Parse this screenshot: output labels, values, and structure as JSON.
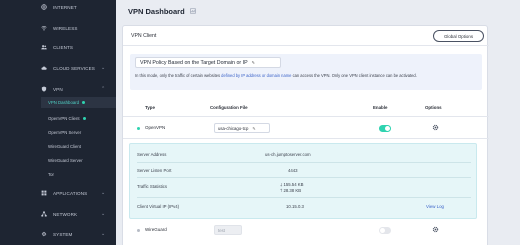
{
  "sidebar": {
    "items": [
      {
        "label": "INTERNET",
        "icon": "globe-icon"
      },
      {
        "label": "WIRELESS",
        "icon": "wifi-icon"
      },
      {
        "label": "CLIENTS",
        "icon": "users-icon"
      },
      {
        "label": "CLOUD SERVICES",
        "icon": "cloud-icon"
      },
      {
        "label": "VPN",
        "icon": "shield-icon"
      },
      {
        "label": "APPLICATIONS",
        "icon": "apps-icon"
      },
      {
        "label": "NETWORK",
        "icon": "network-icon"
      },
      {
        "label": "SYSTEM",
        "icon": "gear-icon"
      }
    ],
    "vpn_sub": [
      {
        "label": "VPN Dashboard",
        "active": true,
        "dot": true
      },
      {
        "label": "OpenVPN Client",
        "active": false,
        "dot": true
      },
      {
        "label": "OpenVPN Server",
        "active": false,
        "dot": false
      },
      {
        "label": "WireGuard Client",
        "active": false,
        "dot": false
      },
      {
        "label": "WireGuard Server",
        "active": false,
        "dot": false
      },
      {
        "label": "Tor",
        "active": false,
        "dot": false
      }
    ]
  },
  "page": {
    "title": "VPN Dashboard"
  },
  "vpn_client": {
    "title": "VPN Client",
    "global_options": "Global Options",
    "policy": {
      "selected": "VPN Policy Based on the Target Domain or IP",
      "desc_pre": "In this mode, only the traffic of certain websites",
      "desc_link": "defined by IP address or domain name",
      "desc_post": "can access the VPN. Only one VPN client instance can be activated."
    },
    "columns": {
      "type": "Type",
      "config": "Configuration File",
      "enable": "Enable",
      "options": "Options"
    },
    "rows": [
      {
        "type": "OpenVPN",
        "config": "usa-chicago-tcp",
        "enabled": true,
        "status_color": "#2fd3b0"
      },
      {
        "type": "WireGuard",
        "config": "test",
        "enabled": false,
        "status_color": "#b7bcc6"
      }
    ],
    "details": {
      "server_address_label": "Server Address",
      "server_address": "us-ch.jumptoserver.com",
      "server_port_label": "Server Listen Port",
      "server_port": "4443",
      "traffic_label": "Traffic Statistics",
      "traffic_down": "155.54 KB",
      "traffic_up": "28.38 KB",
      "client_ip_label": "Client Virtual IP (IPv4)",
      "client_ip": "10.15.0.3",
      "view_log": "View Log"
    }
  },
  "colors": {
    "sidebar_bg": "#1e2532",
    "accent": "#2fd3b0",
    "link": "#3b63c9"
  }
}
